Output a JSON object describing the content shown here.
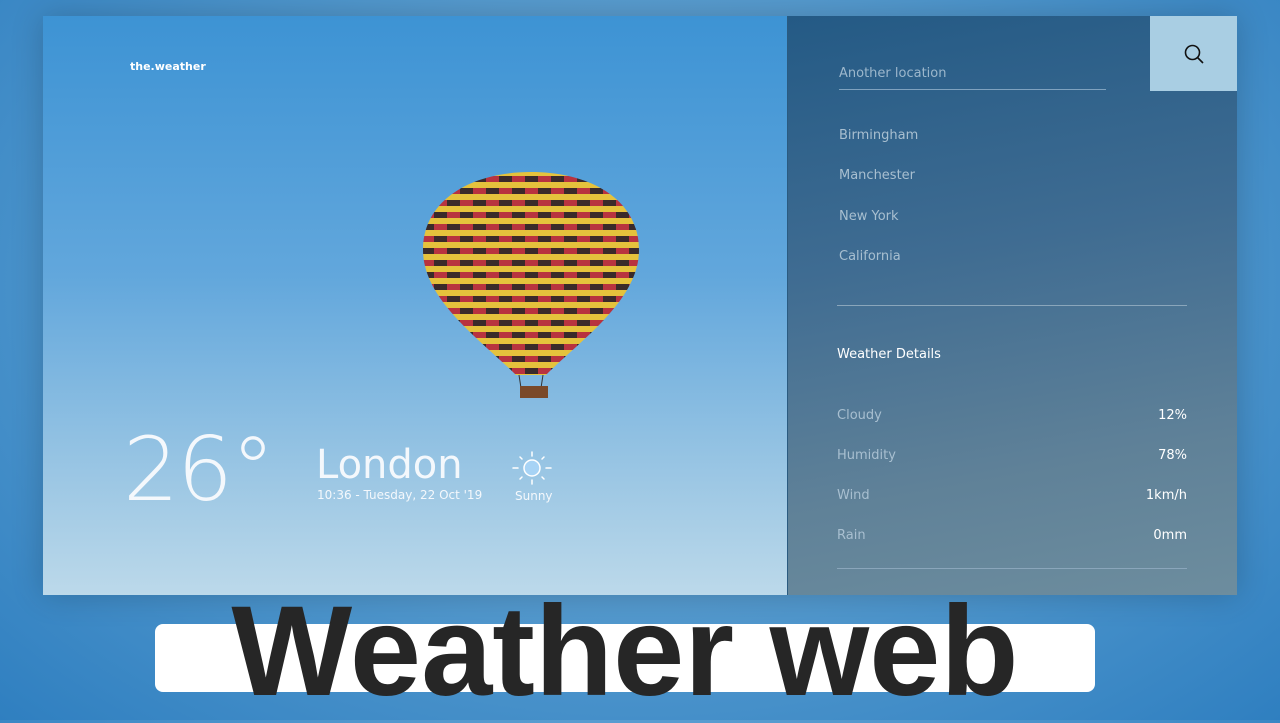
{
  "brand": "the.weather",
  "current": {
    "temperature": "26°",
    "city": "London",
    "datetime": "10:36 - Tuesday, 22 Oct '19",
    "condition": "Sunny",
    "condition_icon": "sun-icon"
  },
  "search": {
    "placeholder": "Another location",
    "button_icon": "search-icon"
  },
  "locations": [
    "Birmingham",
    "Manchester",
    "New York",
    "California"
  ],
  "details": {
    "heading": "Weather Details",
    "rows": [
      {
        "label": "Cloudy",
        "value": "12%"
      },
      {
        "label": "Humidity",
        "value": "78%"
      },
      {
        "label": "Wind",
        "value": "1km/h"
      },
      {
        "label": "Rain",
        "value": "0mm"
      }
    ]
  },
  "banner_title": "Weather web",
  "colors": {
    "search_button": "#a9cee3",
    "panel": "#245a85"
  }
}
